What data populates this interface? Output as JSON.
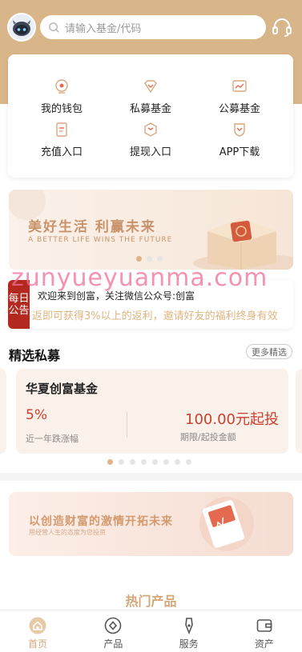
{
  "search": {
    "placeholder": "请输入基金/代码"
  },
  "menu": {
    "items": [
      {
        "label": "我的钱包",
        "icon": "wallet-icon"
      },
      {
        "label": "私募基金",
        "icon": "diamond-icon"
      },
      {
        "label": "公募基金",
        "icon": "chart-icon"
      },
      {
        "label": "充值入口",
        "icon": "recharge-icon"
      },
      {
        "label": "提现入口",
        "icon": "box-icon"
      },
      {
        "label": "APP下载",
        "icon": "shield-icon"
      }
    ]
  },
  "banner1": {
    "title": "美好生活 利赢未来",
    "subtitle": "A BETTER LIFE WINS THE FUTURE"
  },
  "watermark": "zunyueyuanma.com",
  "notice": {
    "badge_top": "每日",
    "badge_bottom": "公告",
    "line1": "欢迎来到创富，关注微信公众号:创富",
    "line2": "返即可获得3%以上的返利，邀请好友的福利终身有效"
  },
  "section": {
    "title": "精选私募",
    "more": "更多精选"
  },
  "fund": {
    "name": "华夏创富基金",
    "rate": "5%",
    "rate_label": "近一年跌涨幅",
    "amount": "100.00元起投",
    "amount_label": "期限/起投金额"
  },
  "banner2": {
    "title": "以创造财富的激情开拓未来",
    "subtitle": "用经营人生的态度为您投资"
  },
  "hot": {
    "title": "热门产品"
  },
  "tabbar": [
    {
      "label": "首页",
      "icon": "home-icon",
      "active": true
    },
    {
      "label": "产品",
      "icon": "product-icon",
      "active": false
    },
    {
      "label": "服务",
      "icon": "service-icon",
      "active": false
    },
    {
      "label": "资产",
      "icon": "assets-icon",
      "active": false
    }
  ],
  "colors": {
    "brand": "#d9b58a",
    "accent": "#c8412e",
    "notice_badge": "#b3281f"
  }
}
